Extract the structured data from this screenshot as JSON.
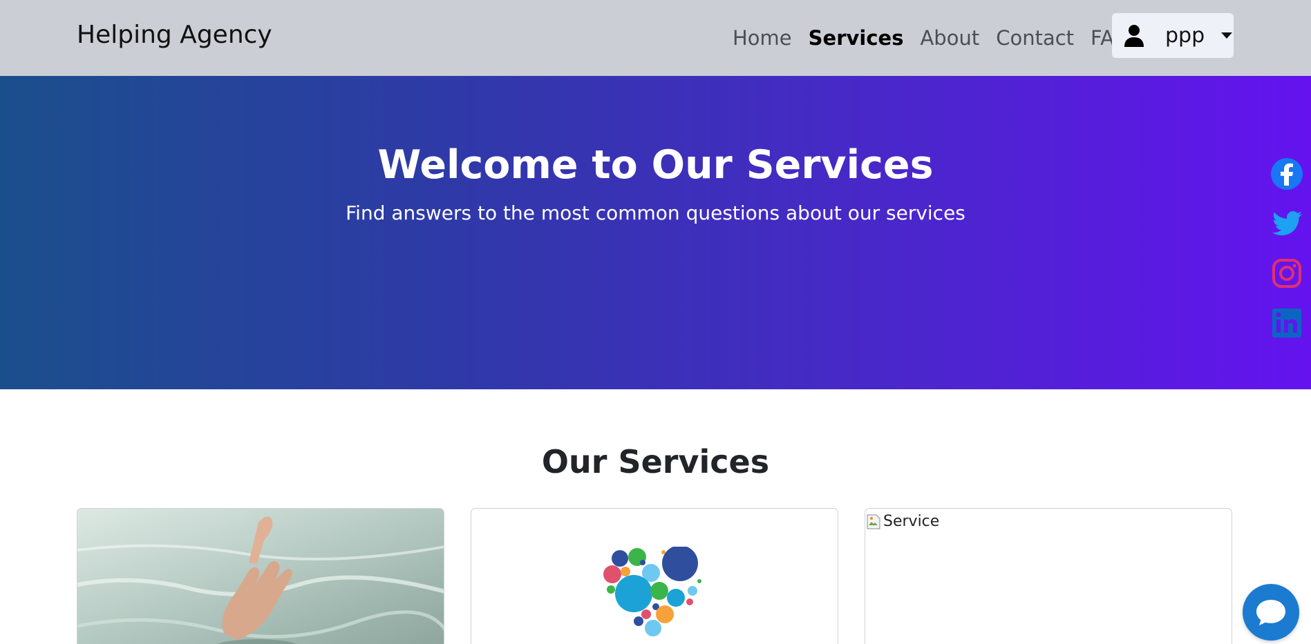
{
  "navbar": {
    "brand": "Helping Agency",
    "links": [
      {
        "label": "Home",
        "active": false
      },
      {
        "label": "Services",
        "active": true
      },
      {
        "label": "About",
        "active": false
      },
      {
        "label": "Contact",
        "active": false
      },
      {
        "label": "FAQs",
        "active": false
      }
    ],
    "user": {
      "name": "ppp",
      "icon": "person-icon"
    }
  },
  "hero": {
    "title": "Welcome to Our Services",
    "subtitle": "Find answers to the most common questions about our services",
    "gradient_colors": [
      "#1b4f8c",
      "#6413ef"
    ]
  },
  "social": [
    {
      "icon": "facebook-icon",
      "color": "#1877f2"
    },
    {
      "icon": "twitter-icon",
      "color": "#1da1f2"
    },
    {
      "icon": "instagram-icon",
      "color": "#e1306c"
    },
    {
      "icon": "linkedin-icon",
      "color": "#0a66c2"
    }
  ],
  "services": {
    "title": "Our Services",
    "cards": [
      {
        "image": "hand-in-water-photo"
      },
      {
        "image": "bubble-heart-logo"
      },
      {
        "image_alt": "Service",
        "image": "broken-image-icon"
      }
    ]
  },
  "chat": {
    "icon": "chat-bubble-icon",
    "color": "#1b7bd0"
  }
}
